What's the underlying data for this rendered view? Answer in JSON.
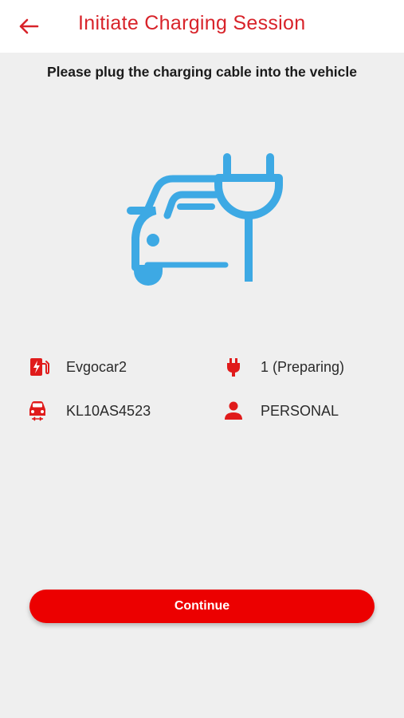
{
  "header": {
    "title": "Initiate Charging Session",
    "back_icon": "arrow-left-icon"
  },
  "instruction": "Please plug the charging cable into the vehicle",
  "illustration": {
    "icon": "car-plug-icon",
    "color": "#3da9e4"
  },
  "info": {
    "station": {
      "icon": "charging-station-icon",
      "value": "Evgocar2"
    },
    "connector": {
      "icon": "plug-icon",
      "value": "1 (Preparing)"
    },
    "vehicle": {
      "icon": "car-icon",
      "value": "KL10AS4523"
    },
    "account_type": {
      "icon": "person-icon",
      "value": "PERSONAL"
    }
  },
  "continue_button": {
    "label": "Continue"
  },
  "colors": {
    "accent": "#ec0000",
    "title": "#d8232a",
    "background": "#efefef",
    "illustration": "#3da9e4"
  }
}
